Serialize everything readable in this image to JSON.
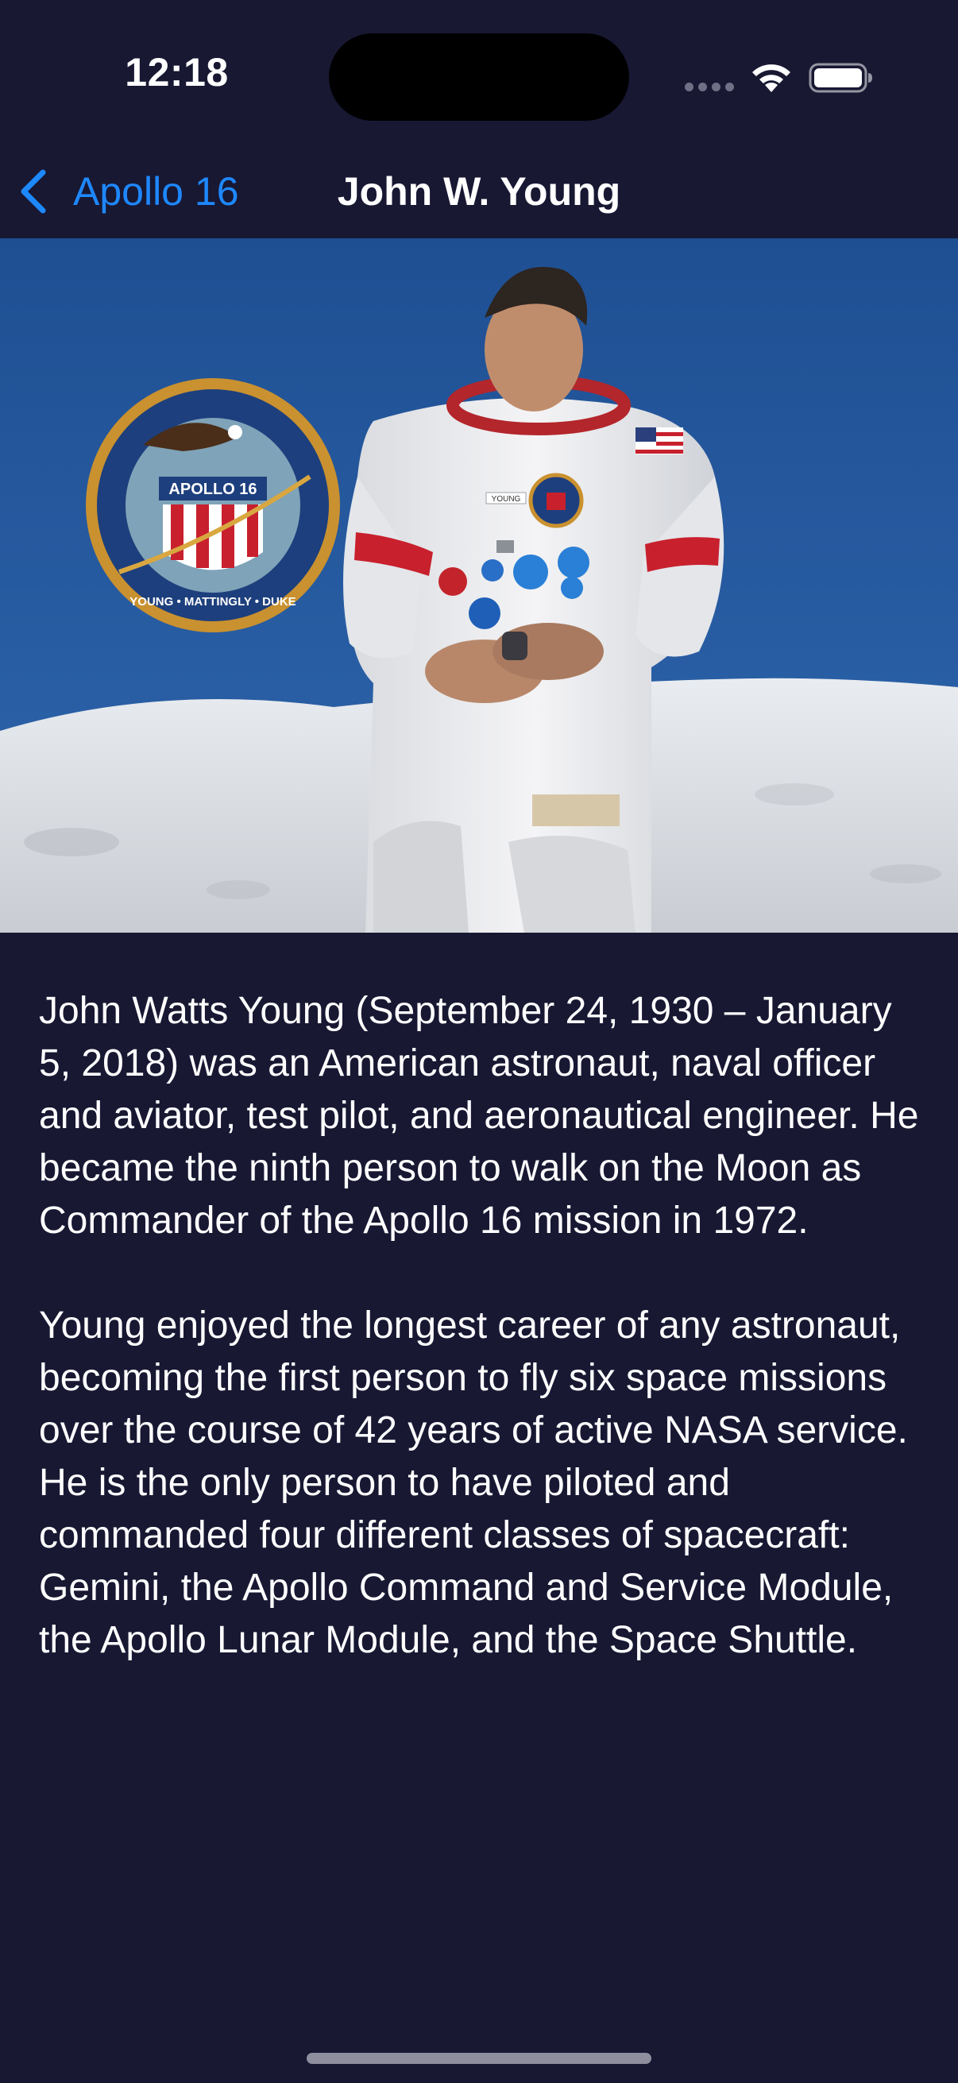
{
  "status_bar": {
    "time": "12:18"
  },
  "nav": {
    "back_label": "Apollo 16",
    "title": "John W. Young",
    "accent_color": "#1e88ff"
  },
  "hero_image": {
    "patch_text": "APOLLO 16",
    "patch_ring_text": "YOUNG • MATTINGLY • DUKE",
    "name_tag": "YOUNG"
  },
  "content": {
    "paragraphs": [
      "John Watts Young (September 24, 1930 – January 5, 2018) was an American astronaut, naval officer and aviator, test pilot, and aeronautical engineer. He became the ninth person to walk on the Moon as Commander of the Apollo 16 mission in 1972.",
      "Young enjoyed the longest career of any astronaut, becoming the first person to fly six space missions over the course of 42 years of active NASA service. He is the only person to have piloted and commanded four different classes of spacecraft: Gemini, the Apollo Command and Service Module, the Apollo Lunar Module, and the Space Shuttle."
    ]
  },
  "theme": {
    "background": "#181833",
    "text": "#ffffff"
  }
}
